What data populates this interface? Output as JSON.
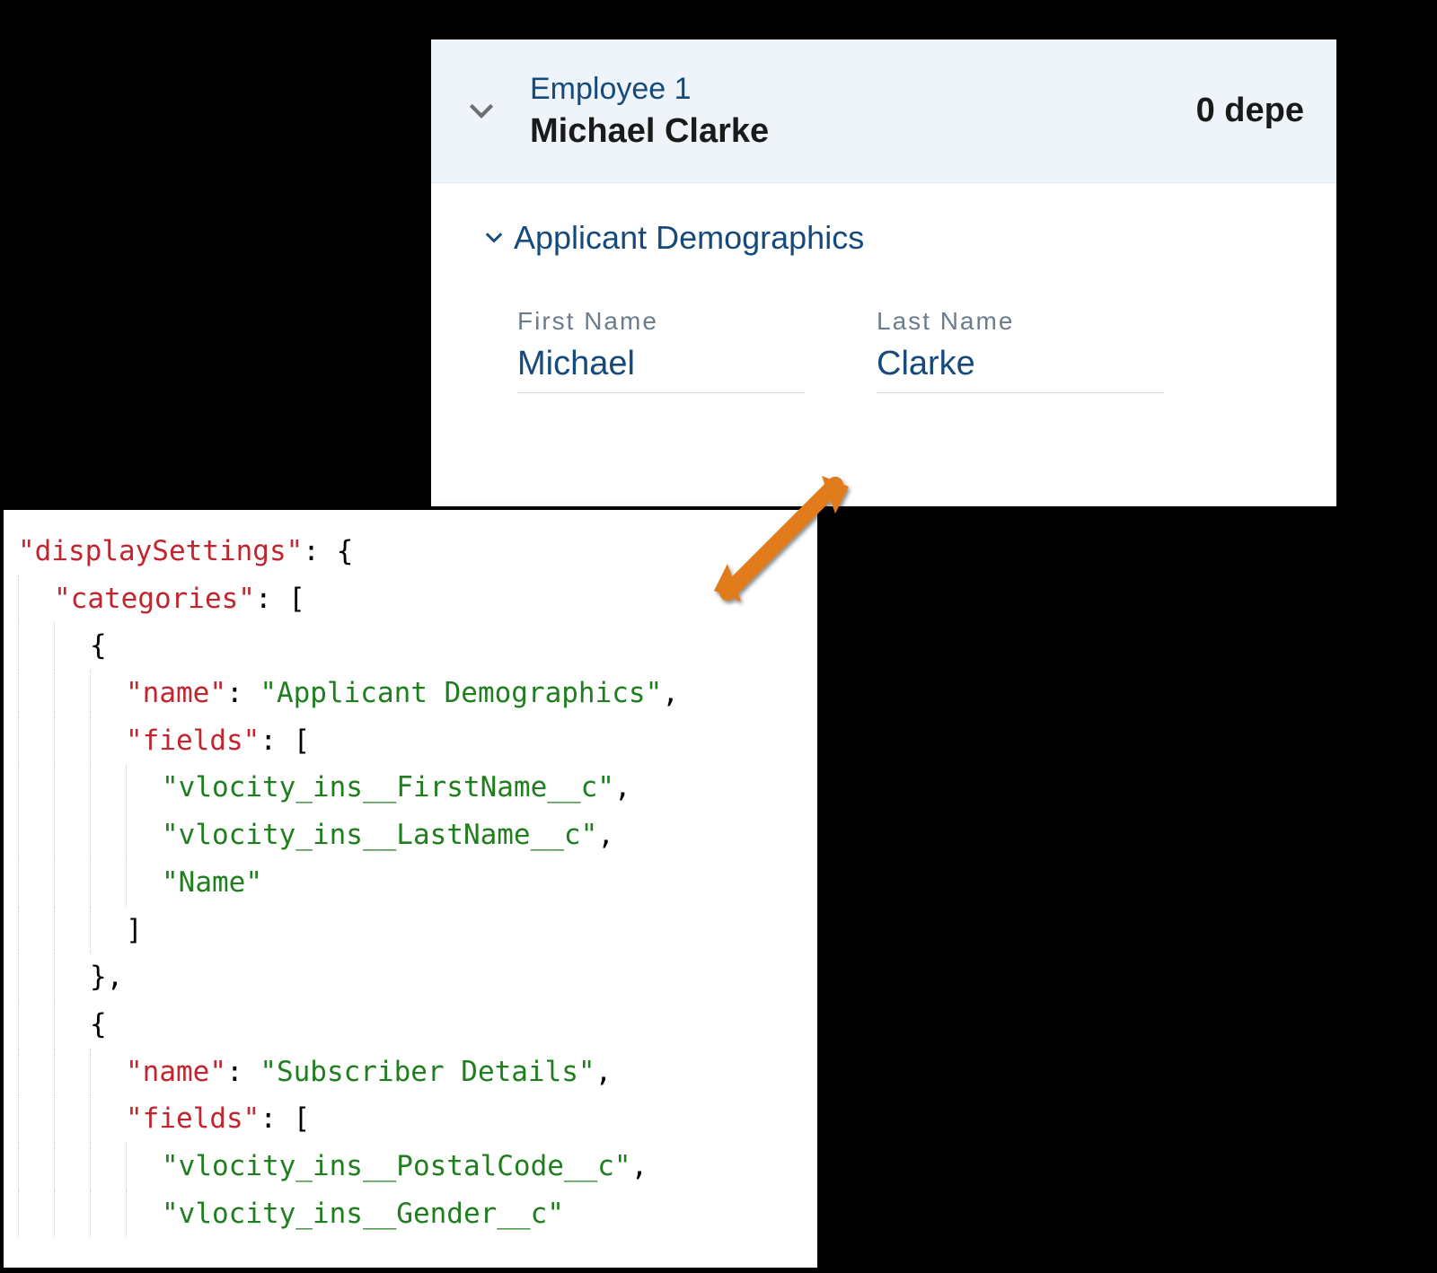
{
  "employee_card": {
    "header": {
      "subtitle": "Employee 1",
      "name": "Michael Clarke",
      "dependents_text": "0 depe"
    },
    "section": {
      "title": "Applicant Demographics",
      "fields": [
        {
          "label": "First Name",
          "value": "Michael"
        },
        {
          "label": "Last Name",
          "value": "Clarke"
        }
      ]
    }
  },
  "json_code": {
    "lines": [
      {
        "indent": 0,
        "type": "kv-open",
        "key": "\"displaySettings\"",
        "after": ": {"
      },
      {
        "indent": 1,
        "type": "kv-open",
        "key": "\"categories\"",
        "after": ": ["
      },
      {
        "indent": 2,
        "type": "plain",
        "text": "{"
      },
      {
        "indent": 3,
        "type": "kv",
        "key": "\"name\"",
        "val": "\"Applicant Demographics\"",
        "suffix": ","
      },
      {
        "indent": 3,
        "type": "kv-open",
        "key": "\"fields\"",
        "after": ": ["
      },
      {
        "indent": 4,
        "type": "str",
        "val": "\"vlocity_ins__FirstName__c\"",
        "suffix": ","
      },
      {
        "indent": 4,
        "type": "str",
        "val": "\"vlocity_ins__LastName__c\"",
        "suffix": ","
      },
      {
        "indent": 4,
        "type": "str",
        "val": "\"Name\"",
        "suffix": ""
      },
      {
        "indent": 3,
        "type": "plain",
        "text": "]"
      },
      {
        "indent": 2,
        "type": "plain",
        "text": "},"
      },
      {
        "indent": 2,
        "type": "plain",
        "text": "{"
      },
      {
        "indent": 3,
        "type": "kv",
        "key": "\"name\"",
        "val": "\"Subscriber Details\"",
        "suffix": ","
      },
      {
        "indent": 3,
        "type": "kv-open",
        "key": "\"fields\"",
        "after": ": ["
      },
      {
        "indent": 4,
        "type": "str",
        "val": "\"vlocity_ins__PostalCode__c\"",
        "suffix": ","
      },
      {
        "indent": 4,
        "type": "str",
        "val": "\"vlocity_ins__Gender__c\"",
        "suffix": ""
      }
    ]
  }
}
